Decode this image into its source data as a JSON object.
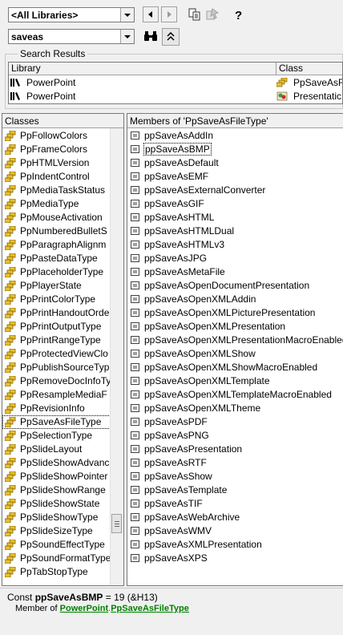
{
  "toolbar": {
    "library_value": "<All Libraries>",
    "search_value": "saveas"
  },
  "search_results": {
    "title": "Search Results",
    "columns": [
      "Library",
      "Class"
    ],
    "rows": [
      {
        "library": "PowerPoint",
        "class": "PpSaveAsF"
      },
      {
        "library": "PowerPoint",
        "class": "Presentatic"
      }
    ]
  },
  "classes": {
    "header": "Classes",
    "items": [
      "PpFollowColors",
      "PpFrameColors",
      "PpHTMLVersion",
      "PpIndentControl",
      "PpMediaTaskStatus",
      "PpMediaType",
      "PpMouseActivation",
      "PpNumberedBulletS",
      "PpParagraphAlignm",
      "PpPasteDataType",
      "PpPlaceholderType",
      "PpPlayerState",
      "PpPrintColorType",
      "PpPrintHandoutOrde",
      "PpPrintOutputType",
      "PpPrintRangeType",
      "PpProtectedViewClo",
      "PpPublishSourceTyp",
      "PpRemoveDocInfoTy",
      "PpResampleMediaF",
      "PpRevisionInfo",
      "PpSaveAsFileType",
      "PpSelectionType",
      "PpSlideLayout",
      "PpSlideShowAdvanc",
      "PpSlideShowPointer",
      "PpSlideShowRange",
      "PpSlideShowState",
      "PpSlideShowType",
      "PpSlideSizeType",
      "PpSoundEffectType",
      "PpSoundFormatType",
      "PpTabStopType"
    ]
  },
  "members": {
    "header": "Members of 'PpSaveAsFileType'",
    "items": [
      "ppSaveAsAddIn",
      "ppSaveAsBMP",
      "ppSaveAsDefault",
      "ppSaveAsEMF",
      "ppSaveAsExternalConverter",
      "ppSaveAsGIF",
      "ppSaveAsHTML",
      "ppSaveAsHTMLDual",
      "ppSaveAsHTMLv3",
      "ppSaveAsJPG",
      "ppSaveAsMetaFile",
      "ppSaveAsOpenDocumentPresentation",
      "ppSaveAsOpenXMLAddin",
      "ppSaveAsOpenXMLPicturePresentation",
      "ppSaveAsOpenXMLPresentation",
      "ppSaveAsOpenXMLPresentationMacroEnabled",
      "ppSaveAsOpenXMLShow",
      "ppSaveAsOpenXMLShowMacroEnabled",
      "ppSaveAsOpenXMLTemplate",
      "ppSaveAsOpenXMLTemplateMacroEnabled",
      "ppSaveAsOpenXMLTheme",
      "ppSaveAsPDF",
      "ppSaveAsPNG",
      "ppSaveAsPresentation",
      "ppSaveAsRTF",
      "ppSaveAsShow",
      "ppSaveAsTemplate",
      "ppSaveAsTIF",
      "ppSaveAsWebArchive",
      "ppSaveAsWMV",
      "ppSaveAsXMLPresentation",
      "ppSaveAsXPS"
    ]
  },
  "details": {
    "prefix": "Const ",
    "name": "ppSaveAsBMP",
    "value": " = 19 (&H13)",
    "member_of": "Member of ",
    "library_link": "PowerPoint",
    "dot": ".",
    "class_link": "PpSaveAsFileType"
  }
}
